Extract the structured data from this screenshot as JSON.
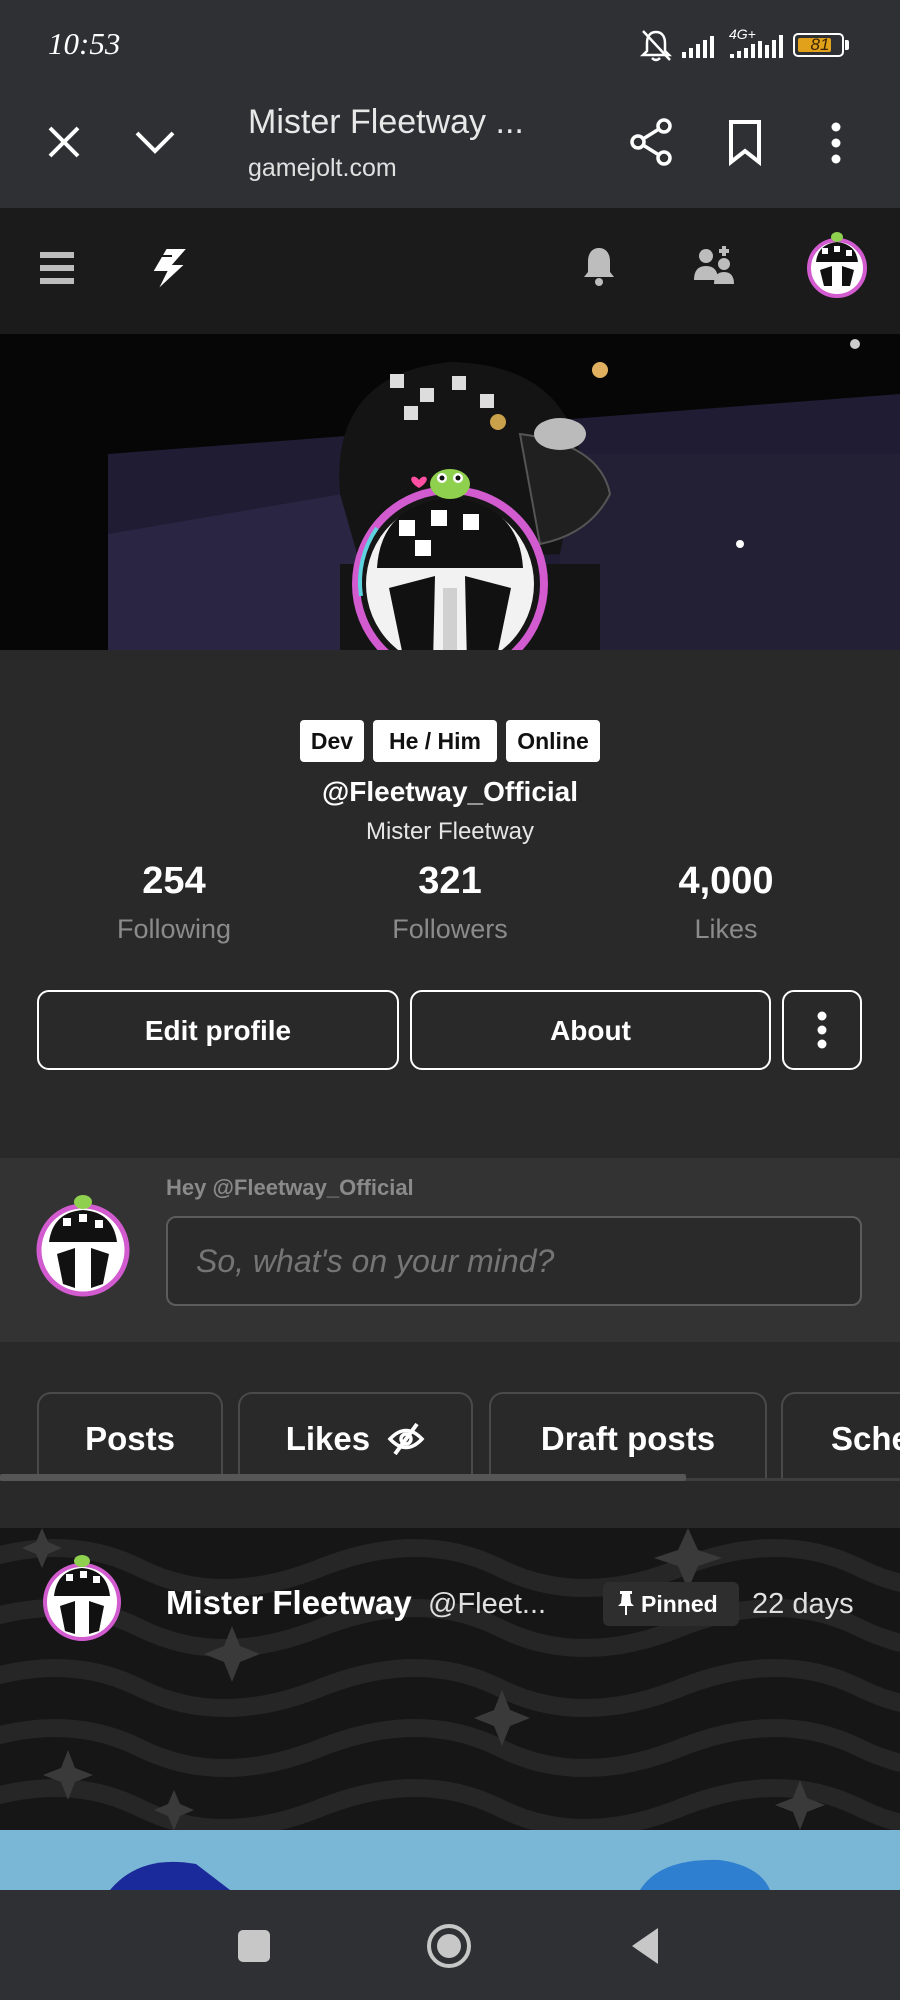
{
  "status_bar": {
    "time": "10:53",
    "network_label": "4G+",
    "battery_level": "81",
    "icons": [
      "mute-bell-icon",
      "signal-icon",
      "signal-icon",
      "battery-icon"
    ]
  },
  "browser": {
    "title": "Mister Fleetway ...",
    "url": "gamejolt.com",
    "icons": [
      "close-icon",
      "chevron-down-icon",
      "share-icon",
      "bookmark-icon",
      "more-vert-icon"
    ]
  },
  "site_nav": {
    "icons": [
      "menu-icon",
      "gamejolt-logo-icon",
      "bell-icon",
      "friends-icon",
      "avatar"
    ]
  },
  "profile": {
    "tags": [
      "Dev",
      "He / Him",
      "Online"
    ],
    "handle": "@Fleetway_Official",
    "display_name": "Mister Fleetway",
    "stats": [
      {
        "value": "254",
        "label": "Following"
      },
      {
        "value": "321",
        "label": "Followers"
      },
      {
        "value": "4,000",
        "label": "Likes"
      }
    ],
    "buttons": {
      "edit": "Edit profile",
      "about": "About"
    }
  },
  "composer": {
    "greeting": "Hey @Fleetway_Official",
    "placeholder": "So, what's on your mind?"
  },
  "tabs": [
    {
      "label": "Posts",
      "active": true
    },
    {
      "label": "Likes",
      "icon": "eye-off-icon"
    },
    {
      "label": "Draft posts"
    },
    {
      "label": "Sche"
    }
  ],
  "post": {
    "author": "Mister Fleetway",
    "handle": "@Fleet...",
    "pinned_label": "Pinned",
    "time": "22 days"
  },
  "colors": {
    "background": "#292929",
    "toolbar": "#2f3033",
    "avatar_ring": "#d25bd0",
    "battery": "#e2a11b",
    "post_image_sky": "#7ab6d6"
  }
}
